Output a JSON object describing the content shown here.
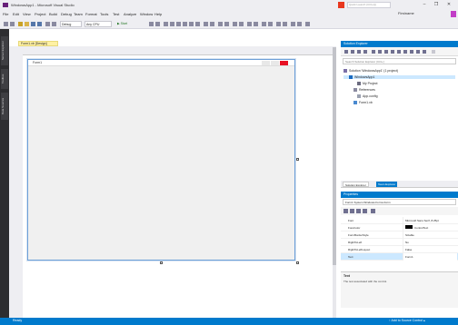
{
  "window": {
    "title": "WindowsApp1 - Microsoft Visual Studio",
    "quick_launch_placeholder": "Quick Launch (Ctrl+Q)",
    "minimize": "–",
    "restore": "❐",
    "close": "✕"
  },
  "menu": [
    "File",
    "Edit",
    "View",
    "Project",
    "Build",
    "Debug",
    "Team",
    "Format",
    "Tools",
    "Test",
    "Analyze",
    "Window",
    "Help"
  ],
  "user": {
    "name": "Firstname"
  },
  "toolbar": {
    "config": "Debug",
    "platform": "Any CPU",
    "start_label": "▶ Start"
  },
  "left_tabs": [
    "Server Explorer",
    "Toolbox",
    "Data Sources"
  ],
  "document": {
    "tab_label": "Form1.vb [Design]",
    "form_title": "Form1"
  },
  "solution_explorer": {
    "title": "Solution Explorer",
    "search_placeholder": "Search Solution Explorer (Ctrl+;)",
    "tree": [
      {
        "label": "Solution 'WindowsApp1' (1 project)",
        "indent": 0,
        "selected": false
      },
      {
        "label": "WindowsApp1",
        "indent": 1,
        "selected": true
      },
      {
        "label": "My Project",
        "indent": 2,
        "selected": false
      },
      {
        "label": "References",
        "indent": 2,
        "selected": false
      },
      {
        "label": "App.config",
        "indent": 2,
        "selected": false
      },
      {
        "label": "Form1.vb",
        "indent": 2,
        "selected": false
      }
    ]
  },
  "dock_tabs": [
    "Solution Explorer",
    "Team Explorer"
  ],
  "properties": {
    "title": "Properties",
    "object": "Form1  System.Windows.Forms.Form",
    "rows": [
      {
        "name": "Font",
        "value": "Microsoft Sans Serif, 8.25pt"
      },
      {
        "name": "ForeColor",
        "value": "ControlText"
      },
      {
        "name": "FormBorderStyle",
        "value": "Sizable"
      },
      {
        "name": "RightToLeft",
        "value": "No"
      },
      {
        "name": "RightToLeftLayout",
        "value": "False"
      },
      {
        "name": "Text",
        "value": "Form1"
      }
    ],
    "desc_title": "Text",
    "desc_body": "The text associated with the control."
  },
  "status": {
    "left": "Ready",
    "right": "↑ Add to Source Control ▴"
  },
  "colors": {
    "accent": "#007acc",
    "vs_purple": "#68217a",
    "doc_tab": "#fff1a4"
  }
}
